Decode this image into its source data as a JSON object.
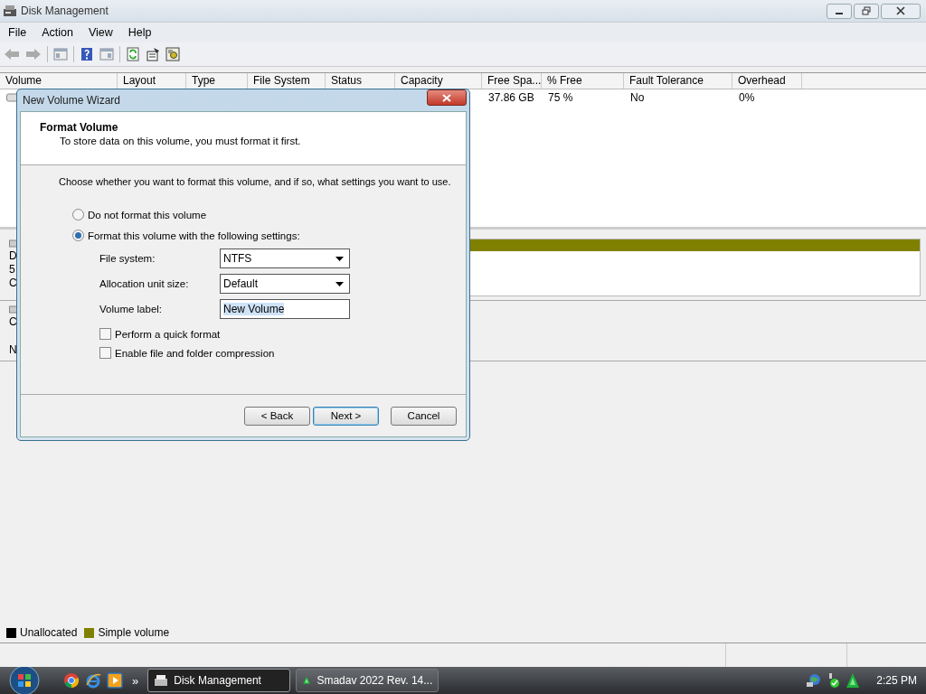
{
  "window": {
    "title": "Disk Management"
  },
  "menu": [
    "File",
    "Action",
    "View",
    "Help"
  ],
  "table": {
    "columns": [
      "Volume",
      "Layout",
      "Type",
      "File System",
      "Status",
      "Capacity",
      "Free Spa...",
      "% Free",
      "Fault Tolerance",
      "Overhead"
    ],
    "rows": [
      {
        "free_space": "37.86 GB",
        "percent_free": "75 %",
        "fault_tolerance": "No",
        "overhead": "0%"
      }
    ]
  },
  "disks": [
    {
      "lines": [
        "D",
        "5",
        "C"
      ],
      "partitions": [
        {
          "kind": "simple"
        }
      ]
    },
    {
      "lines": [
        "C",
        "N"
      ]
    }
  ],
  "legend": [
    {
      "kind": "unallocated",
      "label": "Unallocated",
      "color": "#000000"
    },
    {
      "kind": "simple",
      "label": "Simple volume",
      "color": "#808000"
    }
  ],
  "dialog": {
    "title": "New Volume Wizard",
    "heading": "Format Volume",
    "subheading": "To store data on this volume, you must format it first.",
    "prompt": "Choose whether you want to format this volume, and if so, what settings you want to use.",
    "options": [
      {
        "label": "Do not format this volume",
        "selected": false
      },
      {
        "label": "Format this volume with the following settings:",
        "selected": true
      }
    ],
    "settings": [
      {
        "kind": "dropdown",
        "label": "File system:",
        "value": "NTFS"
      },
      {
        "kind": "dropdown",
        "label": "Allocation unit size:",
        "value": "Default"
      },
      {
        "kind": "text",
        "label": "Volume label:",
        "value": "New Volume",
        "text_selected": true
      }
    ],
    "checkboxes": [
      {
        "label": "Perform a quick format",
        "checked": false
      },
      {
        "label": "Enable file and folder compression",
        "checked": false
      }
    ],
    "buttons": [
      {
        "label": "< Back",
        "default": false
      },
      {
        "label": "Next >",
        "default": true
      },
      {
        "label": "Cancel",
        "default": false
      }
    ]
  },
  "taskbar": {
    "overflow": "»",
    "tasks": [
      {
        "label": "Disk Management",
        "selected": true
      },
      {
        "label": "Smadav 2022 Rev. 14...",
        "selected": false
      }
    ],
    "clock": "2:25 PM"
  }
}
